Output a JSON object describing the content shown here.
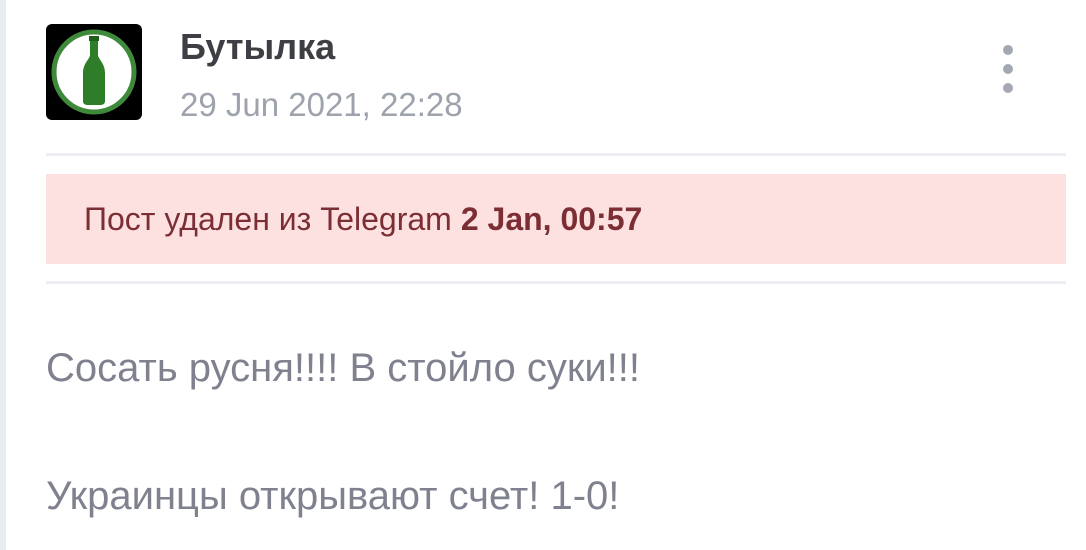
{
  "post": {
    "author": "Бутылка",
    "timestamp": "29 Jun 2021, 22:28",
    "avatar_icon": "green-bottle-icon",
    "more_icon": "more-vertical-icon"
  },
  "deleted_notice": {
    "text": "Пост удален из Telegram",
    "date": "2 Jan, 00:57"
  },
  "content": {
    "lines": [
      "Сосать русня!!!! В стойло суки!!!",
      "Украинцы открывают счет! 1-0!"
    ]
  },
  "colors": {
    "banner_background": "#fde0e0",
    "banner_text": "#7b2e33",
    "avatar_ring": "#3f8a3a",
    "bottle": "#2e7d28"
  }
}
